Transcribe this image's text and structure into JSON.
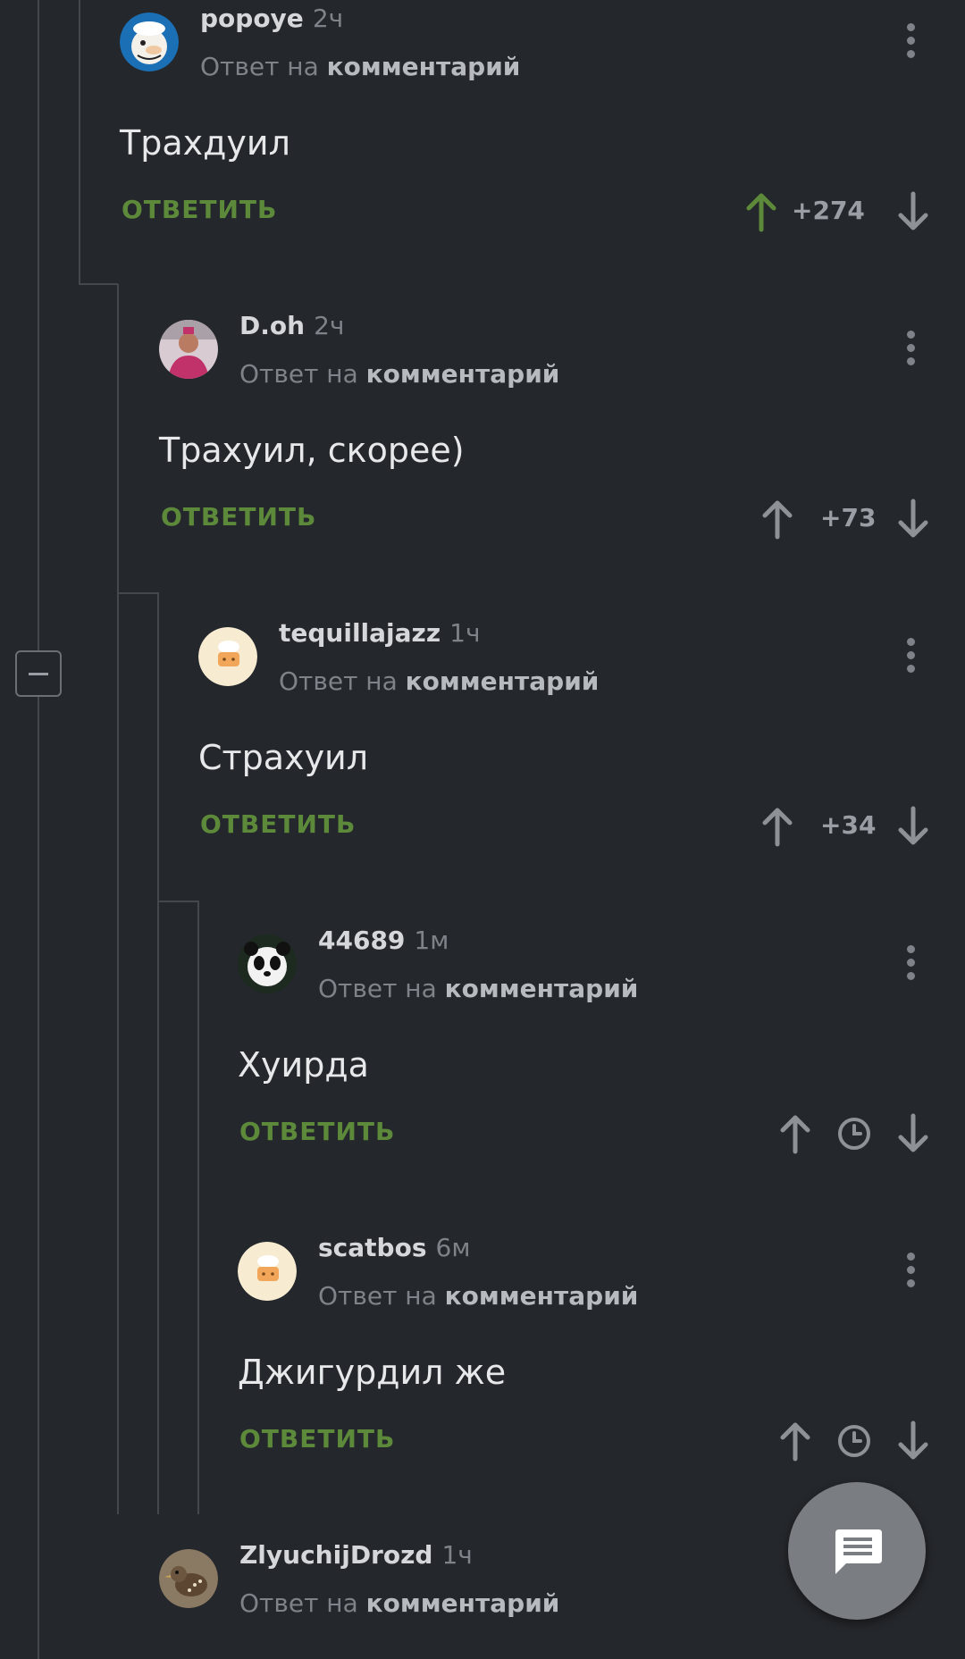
{
  "colors": {
    "background": "#24272b",
    "accent_reply": "#5d8a3a",
    "upvote_active": "#5d8a3a",
    "muted": "#7f8389",
    "thread_line": "#44484d",
    "fab": "#7a7d82"
  },
  "comments": [
    {
      "author": "popoye",
      "time": "2ч",
      "reply_prefix": "Ответ на",
      "reply_target": "комментарий",
      "text": "Трахдуил",
      "reply_label": "ОТВЕТИТЬ",
      "score": "+274",
      "upvoted": true,
      "avatar_icon": "popeye-avatar"
    },
    {
      "author": "D.oh",
      "time": "2ч",
      "reply_prefix": "Ответ на",
      "reply_target": "комментарий",
      "text": "Трахуил, скорее)",
      "reply_label": "ОТВЕТИТЬ",
      "score": "+73",
      "upvoted": false,
      "avatar_icon": "person-avatar"
    },
    {
      "author": "tequillajazz",
      "time": "1ч",
      "reply_prefix": "Ответ на",
      "reply_target": "комментарий",
      "text": "Страхуил",
      "reply_label": "ОТВЕТИТЬ",
      "score": "+34",
      "upvoted": false,
      "avatar_icon": "default-chef-avatar"
    },
    {
      "author": "44689",
      "time": "1м",
      "reply_prefix": "Ответ на",
      "reply_target": "комментарий",
      "text": "Хуирда",
      "reply_label": "ОТВЕТИТЬ",
      "score_hidden_icon": "clock-icon",
      "avatar_icon": "panda-avatar"
    },
    {
      "author": "scatbos",
      "time": "6м",
      "reply_prefix": "Ответ на",
      "reply_target": "комментарий",
      "text": "Джигурдил же",
      "reply_label": "ОТВЕТИТЬ",
      "score_hidden_icon": "clock-icon",
      "avatar_icon": "default-chef-avatar"
    },
    {
      "author": "ZlyuchijDrozd",
      "time": "1ч",
      "reply_prefix": "Ответ на",
      "reply_target": "комментарий",
      "avatar_icon": "bird-avatar"
    }
  ],
  "fab_icon": "comment-icon",
  "collapse_icon": "minus-icon"
}
